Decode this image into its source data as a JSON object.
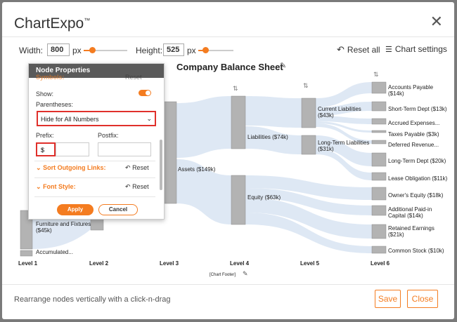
{
  "dialog": {
    "title": "ChartExpo",
    "trademark": "™",
    "close_glyph": "✕"
  },
  "toolbar": {
    "width_label": "Width:",
    "width_value": "800",
    "width_unit": "px",
    "height_label": "Height:",
    "height_value": "525",
    "height_unit": "px",
    "reset_all": "Reset all",
    "chart_settings": "Chart settings"
  },
  "chart": {
    "title": "Company Balance Sheet",
    "levels": [
      "Level 1",
      "Level 2",
      "Level 3",
      "Level 4",
      "Level 5",
      "Level 6"
    ],
    "footer": "[Chart Footer]",
    "labels": {
      "assets": "Assets ($149k)",
      "liabilities": "Liabilities ($74k)",
      "equity": "Equity ($63k)",
      "current_liab_1": "Current Liabilities",
      "current_liab_2": "($43k)",
      "lt_liab_1": "Long-Term Liabilities",
      "lt_liab_2": "($31k)",
      "ap_1": "Accounts Payable",
      "ap_2": "($14k)",
      "std": "Short-Term Dept ($13k)",
      "accrued": "Accrued Expenses...",
      "taxes": "Taxes Payable ($3k)",
      "deferred": "Deferred Revenue...",
      "ltd": "Long-Term Dept ($20k)",
      "lease": "Lease Obligation ($11k)",
      "owner": "Owner's Equity ($18k)",
      "apic_1": "Additional Paid-in",
      "apic_2": "Capital ($14k)",
      "re_1": "Retained Earnings",
      "re_2": "($21k)",
      "cs": "Common Stock ($10k)",
      "ff_1": "Furniture and Fixtures",
      "ff_2": "($45k)",
      "accum": "Accumulated..."
    }
  },
  "panel": {
    "header": "Node Properties",
    "symbols": "Symbols:",
    "symbols_reset": "Reset",
    "show_label": "Show:",
    "parentheses_label": "Parentheses:",
    "parentheses_value": "Hide for All Numbers",
    "prefix_label": "Prefix:",
    "prefix_value": "$",
    "postfix_label": "Postfix:",
    "postfix_value": "",
    "sort_links": "Sort Outgoing Links:",
    "font_style": "Font Style:",
    "reset": "Reset",
    "apply": "Apply",
    "cancel": "Cancel"
  },
  "footer": {
    "hint": "Rearrange nodes vertically with a click-n-drag",
    "save": "Save",
    "close": "Close"
  },
  "colors": {
    "accent": "#f47c20",
    "node": "#b3b3b3",
    "link": "#dbe6f3",
    "highlight": "#e0302b"
  }
}
